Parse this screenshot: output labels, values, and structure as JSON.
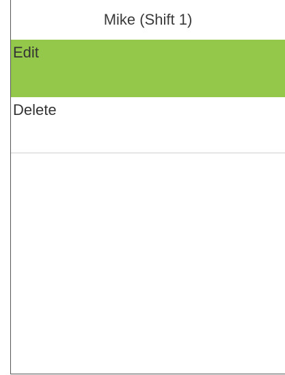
{
  "header": {
    "title": "Mike (Shift 1)"
  },
  "menu": {
    "items": [
      {
        "label": "Edit",
        "selected": true
      },
      {
        "label": "Delete",
        "selected": false
      }
    ]
  },
  "colors": {
    "selected_bg": "#94c84a",
    "divider": "#cfcfcf"
  }
}
